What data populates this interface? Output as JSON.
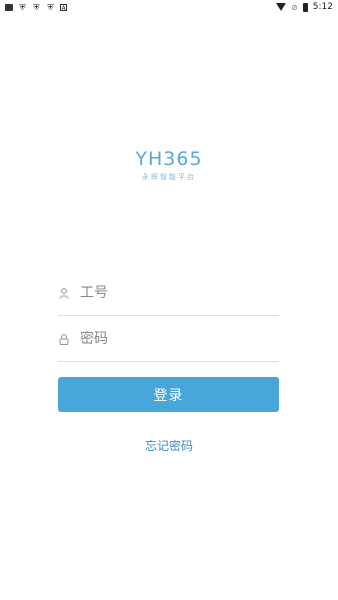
{
  "status_bar": {
    "left_icons": [
      "gallery-icon",
      "shield-icon",
      "shield-icon",
      "shield-icon",
      "app-icon"
    ],
    "app_icon_text": "A",
    "time": "5:12",
    "right_icons": [
      "wifi-icon",
      "no-sim-icon",
      "battery-icon"
    ]
  },
  "logo": {
    "title": "YH365",
    "subtitle": "永辉智能平台",
    "color": "#5aa9d8"
  },
  "form": {
    "employee_id": {
      "placeholder": "工号",
      "value": "",
      "icon": "user-icon"
    },
    "password": {
      "placeholder": "密码",
      "value": "",
      "icon": "lock-icon"
    },
    "login_label": "登录",
    "forgot_label": "忘记密码"
  },
  "colors": {
    "primary": "#49a6d8",
    "link": "#3a8fc4",
    "divider": "#dcdcdc"
  }
}
